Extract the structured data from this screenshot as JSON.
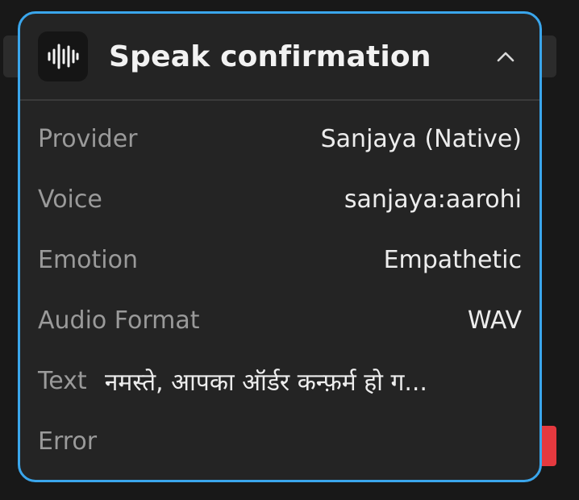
{
  "node": {
    "title": "Speak confirmation",
    "icon": "audio-waveform-icon",
    "collapse_icon": "chevron-up-icon"
  },
  "fields": {
    "provider": {
      "label": "Provider",
      "value": "Sanjaya (Native)"
    },
    "voice": {
      "label": "Voice",
      "value": "sanjaya:aarohi"
    },
    "emotion": {
      "label": "Emotion",
      "value": "Empathetic"
    },
    "audio_format": {
      "label": "Audio Format",
      "value": "WAV"
    },
    "text": {
      "label": "Text",
      "value": "नमस्ते, आपका ऑर्डर कन्फ़र्म हो ग..."
    },
    "error": {
      "label": "Error",
      "value": ""
    }
  },
  "colors": {
    "accent_border": "#3aa6ec",
    "card_bg": "#242424",
    "error_handle": "#e5393f"
  }
}
